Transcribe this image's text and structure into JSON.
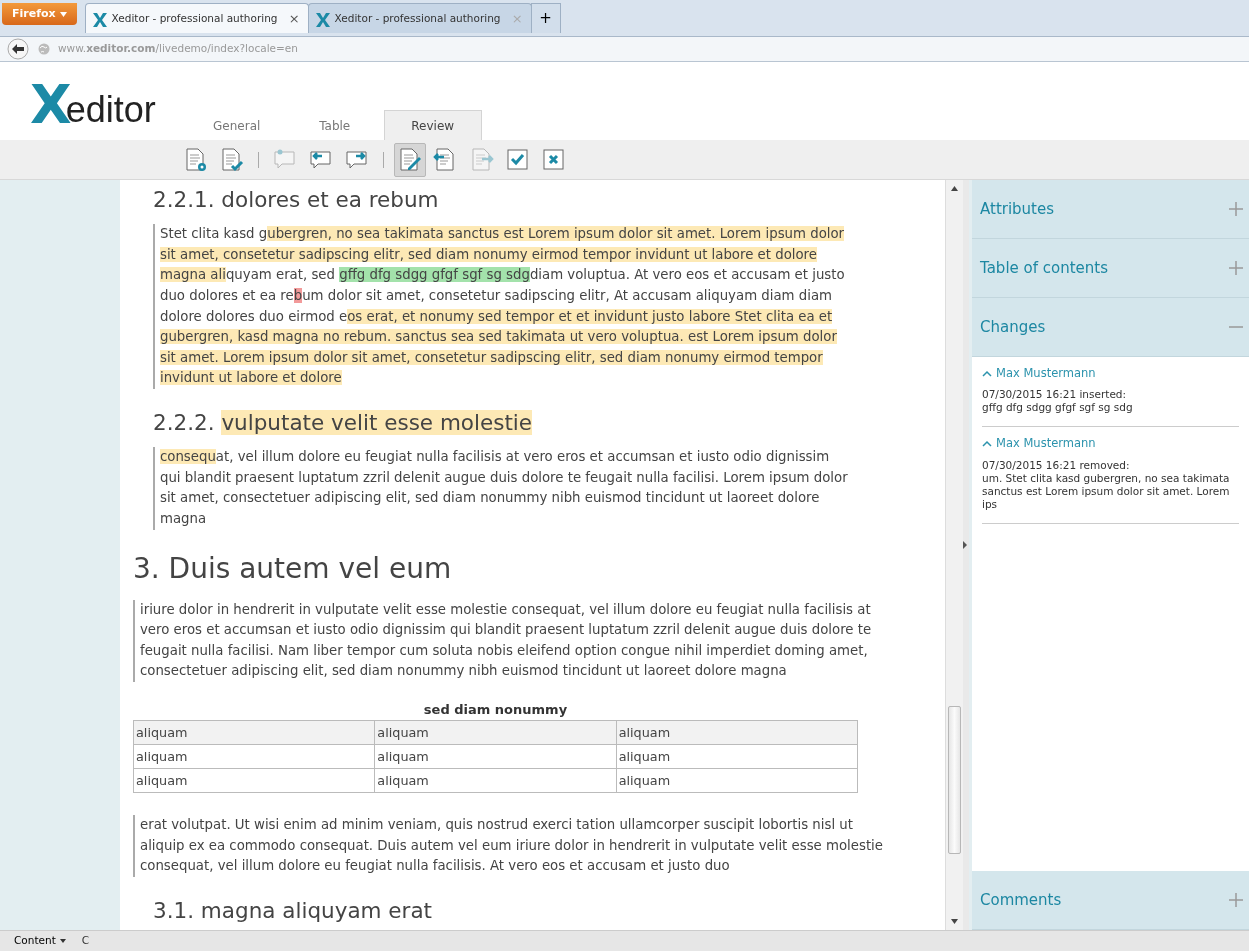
{
  "browser": {
    "menu_button": "Firefox",
    "tabs": [
      {
        "title": "Xeditor - professional authoring",
        "close": "×",
        "selected": true
      },
      {
        "title": "Xeditor - professional authoring",
        "close": "×",
        "selected": false
      }
    ],
    "new_tab": "+",
    "address": "www.**xeditor.com**/livedemo/index?locale=en"
  },
  "app": {
    "logo": {
      "mark": "X",
      "text": "editor"
    },
    "tabs": [
      {
        "label": "General",
        "selected": false
      },
      {
        "label": "Table",
        "selected": false
      },
      {
        "label": "Review",
        "selected": true
      }
    ],
    "toolbar": [
      {
        "kind": "doc-gear",
        "pressed": false,
        "disabled": false
      },
      {
        "kind": "doc-check",
        "pressed": false,
        "disabled": false
      },
      {
        "kind": "separator"
      },
      {
        "kind": "comment-new",
        "pressed": false,
        "disabled": true
      },
      {
        "kind": "comment-prev",
        "pressed": false,
        "disabled": false
      },
      {
        "kind": "comment-next",
        "pressed": false,
        "disabled": false
      },
      {
        "kind": "separator"
      },
      {
        "kind": "track",
        "pressed": true,
        "disabled": false
      },
      {
        "kind": "change-prev",
        "pressed": false,
        "disabled": false
      },
      {
        "kind": "change-next",
        "pressed": false,
        "disabled": true
      },
      {
        "kind": "accept",
        "pressed": false,
        "disabled": false
      },
      {
        "kind": "reject",
        "pressed": false,
        "disabled": false
      }
    ]
  },
  "document": {
    "sections": [
      {
        "children": [
          {
            "heading": [
              {
                "text": "2.2.1. dolores et ea rebum"
              }
            ],
            "blocks": [
              {
                "kind": "paragraph",
                "segments": [
                  {
                    "text": "Stet clita kasd g"
                  },
                  {
                    "text": "ubergren, no sea takimata sanctus est Lorem ipsum dolor sit amet. Lorem ipsum dolor sit amet, consetetur sadipscing elitr, sed diam nonumy eirmod tempor invidunt ut labore et dolore magna ali",
                    "color": "#fde9b5"
                  },
                  {
                    "text": "quyam erat, sed "
                  },
                  {
                    "text": "gffg dfg sdgg gfgf sgf sg sdg",
                    "color": "#a3e2ab"
                  },
                  {
                    "text": "diam voluptua. At vero eos et accusam et justo duo dolores et ea re"
                  },
                  {
                    "text": "b",
                    "color": "#f29a9a"
                  },
                  {
                    "text": "um dolor sit amet, consetetur sadipscing elitr, At accusam aliquyam diam diam dolore dolores duo eirmod e"
                  },
                  {
                    "text": "os erat, et nonumy sed tempor et et invidunt justo labore Stet clita ea et gubergren, kasd magna no rebum. sanctus sea sed takimata ut vero voluptua. est Lorem ipsum dolor sit amet. Lorem ipsum dolor sit amet, consetetur sadipscing elitr, sed diam nonumy eirmod tempor invidunt ut labore et dolore",
                    "color": "#fde9b5"
                  }
                ]
              }
            ]
          },
          {
            "heading": [
              {
                "text": "2.2.2. "
              },
              {
                "text": "vulputate velit esse molestie",
                "color": "#fde9b5"
              }
            ],
            "blocks": [
              {
                "kind": "paragraph",
                "segments": [
                  {
                    "text": "consequ",
                    "color": "#fde9b5"
                  },
                  {
                    "text": "at, vel illum dolore eu feugiat nulla facilisis at vero eros et accumsan et iusto odio dignissim qui blandit praesent luptatum zzril delenit augue duis dolore te feugait nulla facilisi. Lorem ipsum dolor sit amet, consectetuer adipiscing elit, sed diam nonummy nibh euismod tincidunt ut laoreet dolore magna"
                  }
                ]
              }
            ]
          }
        ]
      },
      {
        "heading": [
          {
            "text": "3. Duis autem vel eum"
          }
        ],
        "blocks": [
          {
            "kind": "paragraph",
            "segments": [
              {
                "text": "iriure dolor in hendrerit in vulputate velit esse molestie consequat, vel illum dolore eu feugiat nulla facilisis at vero eros et accumsan et iusto odio dignissim qui blandit praesent luptatum zzril delenit augue duis dolore te feugait nulla facilisi. Nam liber tempor cum soluta nobis eleifend option congue nihil imperdiet doming amet, consectetuer adipiscing elit, sed diam nonummy nibh euismod tincidunt ut laoreet dolore magna"
              }
            ]
          },
          {
            "kind": "table",
            "caption": "sed diam nonummy",
            "rows": [
              [
                "aliquam",
                "aliquam",
                "aliquam"
              ],
              [
                "aliquam",
                "aliquam",
                "aliquam"
              ],
              [
                "aliquam",
                "aliquam",
                "aliquam"
              ]
            ]
          },
          {
            "kind": "paragraph",
            "segments": [
              {
                "text": "erat volutpat. Ut wisi enim ad minim veniam, quis nostrud exerci tation ullamcorper suscipit lobortis nisl ut aliquip ex ea commodo consequat. Duis autem vel eum iriure dolor in hendrerit in vulputate velit esse molestie consequat, vel illum dolore eu feugiat nulla facilisis. At vero eos et accusam et justo duo"
              }
            ]
          }
        ],
        "children": [
          {
            "heading": [
              {
                "text": "3.1. magna aliquyam erat"
              }
            ]
          }
        ]
      }
    ]
  },
  "panel": {
    "sections": [
      {
        "title": "Attributes",
        "expanded": false
      },
      {
        "title": "Table of contents",
        "expanded": false
      },
      {
        "title": "Changes",
        "expanded": true,
        "changes": [
          {
            "author": "Max Mustermann",
            "meta": "07/30/2015 16:21 inserted:",
            "text": "gffg dfg sdgg gfgf sgf sg sdg"
          },
          {
            "author": "Max Mustermann",
            "meta": "07/30/2015 16:21 removed:",
            "text": "um. Stet clita kasd gubergren, no sea takimata sanctus est Lorem ipsum dolor sit amet. Lorem ips"
          }
        ]
      },
      {
        "title": "Comments",
        "expanded": false
      }
    ]
  },
  "status_bar": {
    "menu": "Content",
    "item": "C"
  }
}
